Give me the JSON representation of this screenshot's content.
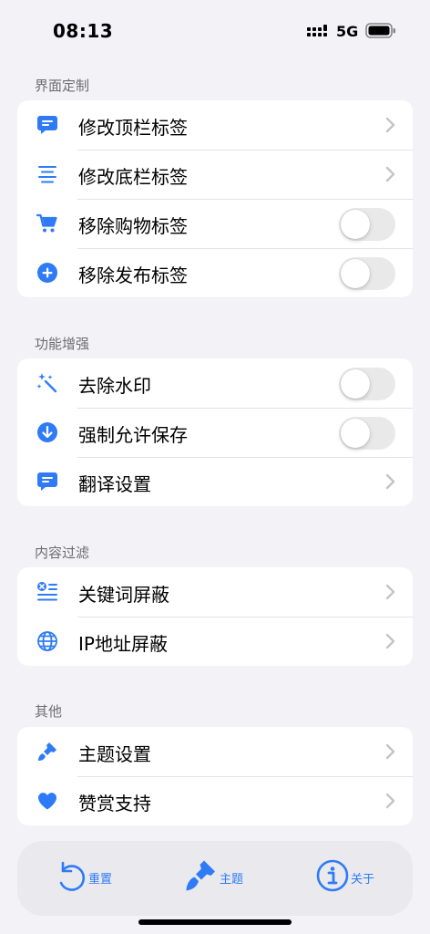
{
  "status_bar": {
    "time": "08:13",
    "network": "5G"
  },
  "colors": {
    "accent": "#2f7bf5",
    "background": "#f2f2f7",
    "toggle_off": "#e9e9ea"
  },
  "sections": [
    {
      "header": "界面定制",
      "items": [
        {
          "label": "修改顶栏标签",
          "icon": "chat-bubble-icon",
          "control": "chevron"
        },
        {
          "label": "修改底栏标签",
          "icon": "text-align-center-icon",
          "control": "chevron"
        },
        {
          "label": "移除购物标签",
          "icon": "cart-icon",
          "control": "toggle",
          "on": false
        },
        {
          "label": "移除发布标签",
          "icon": "plus-circle-icon",
          "control": "toggle",
          "on": false
        }
      ]
    },
    {
      "header": "功能增强",
      "items": [
        {
          "label": "去除水印",
          "icon": "magic-wand-icon",
          "control": "toggle",
          "on": false
        },
        {
          "label": "强制允许保存",
          "icon": "download-circle-icon",
          "control": "toggle",
          "on": false
        },
        {
          "label": "翻译设置",
          "icon": "chat-bubble-icon",
          "control": "chevron"
        }
      ]
    },
    {
      "header": "内容过滤",
      "items": [
        {
          "label": "关键词屏蔽",
          "icon": "text-remove-icon",
          "control": "chevron"
        },
        {
          "label": "IP地址屏蔽",
          "icon": "globe-icon",
          "control": "chevron"
        }
      ]
    },
    {
      "header": "其他",
      "items": [
        {
          "label": "主题设置",
          "icon": "paintbrush-icon",
          "control": "chevron"
        },
        {
          "label": "赞赏支持",
          "icon": "heart-icon",
          "control": "chevron"
        }
      ]
    }
  ],
  "tab_bar": [
    {
      "label": "重置",
      "icon": "reset-icon"
    },
    {
      "label": "主题",
      "icon": "paintbrush-icon"
    },
    {
      "label": "关于",
      "icon": "info-circle-icon"
    }
  ]
}
